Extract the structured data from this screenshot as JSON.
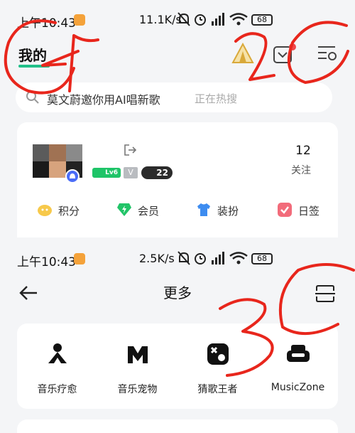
{
  "top_screen": {
    "status_bar": {
      "time": "上午10:43",
      "speed": "11.1K/s",
      "battery": "68"
    },
    "header": {
      "title": "我的"
    },
    "search": {
      "text": "莫文蔚邀你用AI唱新歌",
      "hint": "正在热搜"
    },
    "profile": {
      "level_badge": "Lv6",
      "v_badge": "V",
      "count_badge": "22",
      "follow_count": "12",
      "follow_label": "关注"
    },
    "menu": [
      {
        "label": "积分",
        "icon": "points-icon",
        "color": "#f7c94b"
      },
      {
        "label": "会员",
        "icon": "vip-diamond-icon",
        "color": "#22c468"
      },
      {
        "label": "装扮",
        "icon": "tshirt-icon",
        "color": "#3d8cf0"
      },
      {
        "label": "日签",
        "icon": "daily-checkin-icon",
        "color": "#f26b7a"
      }
    ]
  },
  "bottom_screen": {
    "status_bar": {
      "time": "上午10:43",
      "speed": "2.5K/s",
      "battery": "68"
    },
    "header": {
      "title": "更多"
    },
    "grid": [
      {
        "label": "音乐疗愈",
        "icon": "music-healing-icon"
      },
      {
        "label": "音乐宠物",
        "icon": "music-pet-icon"
      },
      {
        "label": "猜歌王者",
        "icon": "guess-song-icon"
      },
      {
        "label": "MusicZone",
        "icon": "musiczone-sofa-icon"
      }
    ]
  },
  "annotations": [
    {
      "label": "1"
    },
    {
      "label": "2"
    },
    {
      "label": "3"
    }
  ],
  "colors": {
    "accent": "#22c08a",
    "annotation": "#e8261c",
    "background": "#f4f5f7"
  }
}
